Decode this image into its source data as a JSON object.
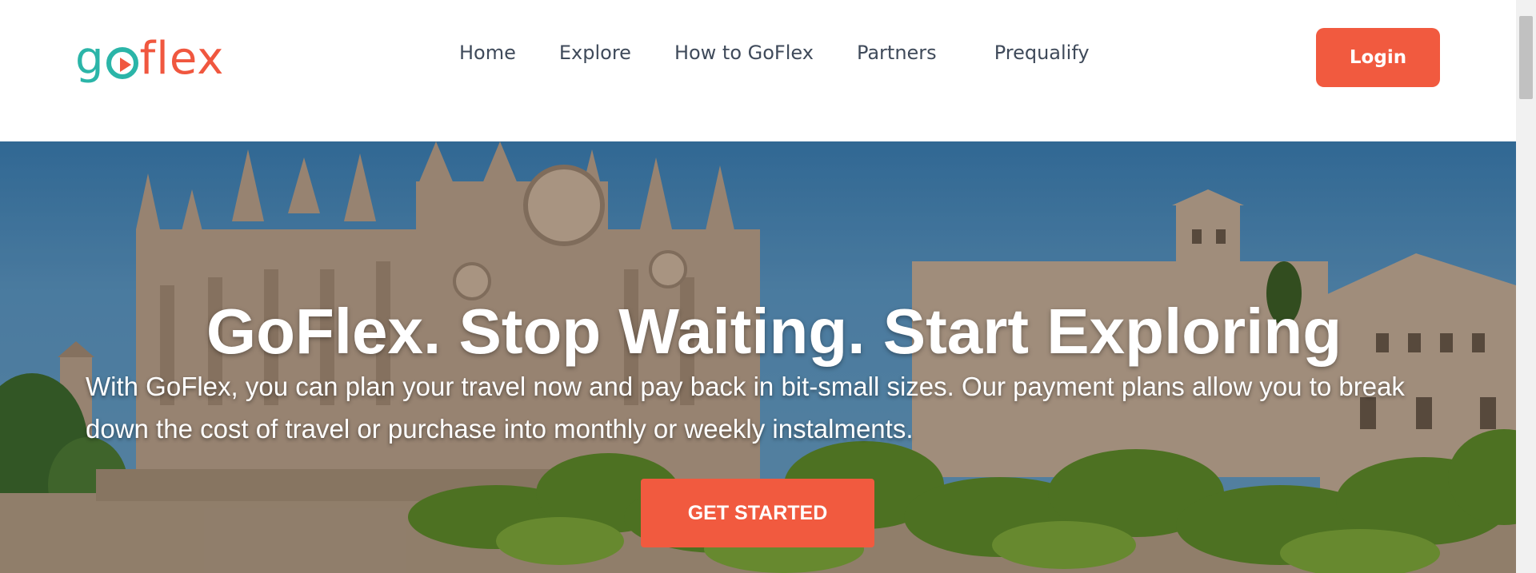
{
  "header": {
    "logo": {
      "part_go": "g",
      "part_flex": "flex",
      "icon": "play-o-icon"
    },
    "nav": [
      {
        "label": "Home"
      },
      {
        "label": "Explore"
      },
      {
        "label": "How to GoFlex"
      },
      {
        "label": "Partners"
      },
      {
        "label": "Prequalify"
      }
    ],
    "login_label": "Login"
  },
  "hero": {
    "title": "GoFlex. Stop Waiting. Start Exploring",
    "subtitle": "With GoFlex, you can plan your travel now and pay back in bit-small sizes. Our payment plans allow you to break down the cost of travel or purchase into monthly or weekly instalments.",
    "cta_label": "GET STARTED",
    "background_description_icon": "cathedral-palm-trees-photo"
  },
  "colors": {
    "accent": "#f15a3f",
    "brand_teal": "#2bb5a8",
    "nav_text": "#3f4a5a"
  }
}
